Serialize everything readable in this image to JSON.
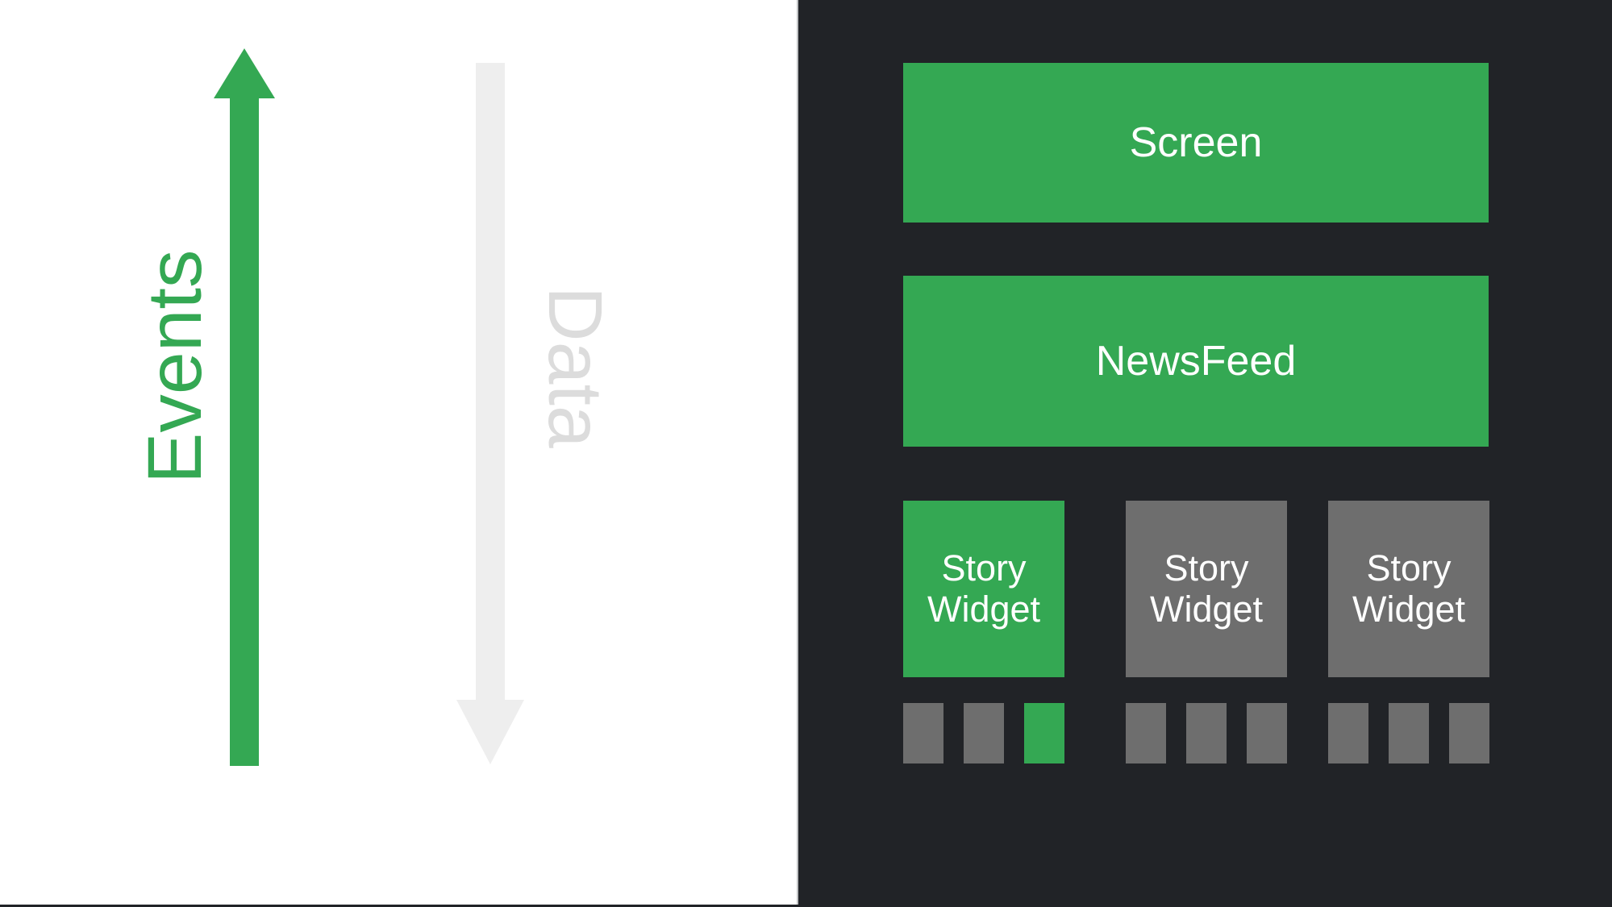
{
  "diagram": {
    "title_hidden": "",
    "colors": {
      "accent_green": "#34a853",
      "panel_dark": "#212327",
      "widget_grey": "#6e6e6e",
      "data_grey": "#dcdcdc",
      "background": "#ffffff",
      "text_light": "#ffffff"
    },
    "flows": [
      {
        "id": "events",
        "label": "Events",
        "direction": "up",
        "color": "#34a853",
        "orientation": "vertical-bottom-to-top"
      },
      {
        "id": "data",
        "label": "Data",
        "direction": "down",
        "color": "#dcdcdc",
        "orientation": "vertical-top-to-bottom"
      }
    ],
    "tree": {
      "screen": {
        "label": "Screen",
        "state": "highlighted"
      },
      "newsfeed": {
        "label": "NewsFeed",
        "state": "highlighted"
      },
      "widgets": [
        {
          "label": "Story\nWidget",
          "line1": "Story",
          "line2": "Widget",
          "state": "highlighted"
        },
        {
          "label": "Story\nWidget",
          "line1": "Story",
          "line2": "Widget",
          "state": "inactive"
        },
        {
          "label": "Story\nWidget",
          "line1": "Story",
          "line2": "Widget",
          "state": "inactive"
        }
      ],
      "chip_groups": [
        {
          "chips": [
            {
              "state": "inactive"
            },
            {
              "state": "inactive"
            },
            {
              "state": "highlighted"
            }
          ]
        },
        {
          "chips": [
            {
              "state": "inactive"
            },
            {
              "state": "inactive"
            },
            {
              "state": "inactive"
            }
          ]
        },
        {
          "chips": [
            {
              "state": "inactive"
            },
            {
              "state": "inactive"
            },
            {
              "state": "inactive"
            }
          ]
        }
      ]
    }
  }
}
